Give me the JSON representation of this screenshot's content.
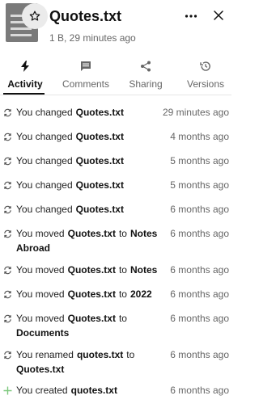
{
  "file": {
    "name": "Quotes.txt",
    "meta": "1 B, 29 minutes ago"
  },
  "icons": {
    "file": "file-text-icon",
    "favorite": "star-outline-icon",
    "menu": "more-horizontal-icon",
    "close": "close-icon"
  },
  "tabs": [
    {
      "label": "Activity",
      "icon": "lightning-icon",
      "active": true
    },
    {
      "label": "Comments",
      "icon": "comment-icon",
      "active": false
    },
    {
      "label": "Sharing",
      "icon": "share-icon",
      "active": false
    },
    {
      "label": "Versions",
      "icon": "history-icon",
      "active": false
    }
  ],
  "activities": [
    {
      "icon": "sync-icon",
      "parts": [
        {
          "t": "You changed"
        },
        {
          "b": "Quotes.txt"
        }
      ],
      "time": "29 minutes ago"
    },
    {
      "icon": "sync-icon",
      "parts": [
        {
          "t": "You changed"
        },
        {
          "b": "Quotes.txt"
        }
      ],
      "time": "4 months ago"
    },
    {
      "icon": "sync-icon",
      "parts": [
        {
          "t": "You changed"
        },
        {
          "b": "Quotes.txt"
        }
      ],
      "time": "5 months ago"
    },
    {
      "icon": "sync-icon",
      "parts": [
        {
          "t": "You changed"
        },
        {
          "b": "Quotes.txt"
        }
      ],
      "time": "5 months ago"
    },
    {
      "icon": "sync-icon",
      "parts": [
        {
          "t": "You changed"
        },
        {
          "b": "Quotes.txt"
        }
      ],
      "time": "6 months ago"
    },
    {
      "icon": "sync-icon",
      "parts": [
        {
          "t": "You moved"
        },
        {
          "b": "Quotes.txt"
        },
        {
          "t": "to"
        },
        {
          "b": "Notes Abroad"
        }
      ],
      "time": "6 months ago"
    },
    {
      "icon": "sync-icon",
      "parts": [
        {
          "t": "You moved"
        },
        {
          "b": "Quotes.txt"
        },
        {
          "t": "to"
        },
        {
          "b": "Notes"
        }
      ],
      "time": "6 months ago"
    },
    {
      "icon": "sync-icon",
      "parts": [
        {
          "t": "You moved"
        },
        {
          "b": "Quotes.txt"
        },
        {
          "t": "to"
        },
        {
          "b": "2022"
        }
      ],
      "time": "6 months ago"
    },
    {
      "icon": "sync-icon",
      "parts": [
        {
          "t": "You moved"
        },
        {
          "b": "Quotes.txt"
        },
        {
          "t": "to"
        },
        {
          "b": "Documents"
        }
      ],
      "time": "6 months ago"
    },
    {
      "icon": "sync-icon",
      "parts": [
        {
          "t": "You renamed"
        },
        {
          "b": "quotes.txt"
        },
        {
          "t": "to"
        },
        {
          "b": "Quotes.txt"
        }
      ],
      "time": "6 months ago"
    },
    {
      "icon": "plus-icon",
      "parts": [
        {
          "t": "You created"
        },
        {
          "b": "quotes.txt"
        }
      ],
      "time": "6 months ago"
    }
  ],
  "colors": {
    "created_icon": "#7dc87d",
    "sync_icon": "#555555",
    "muted_text": "#666666"
  }
}
